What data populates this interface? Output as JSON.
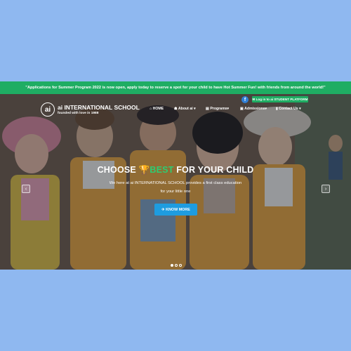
{
  "announcement": "\"Applications for Summer Program 2022 is now open, apply today to reserve a spot for your child to have Hot Summer Fun! with friends from around the world!\"",
  "logo": {
    "mark": "ai",
    "name": "ai INTERNATIONAL SCHOOL",
    "tagline": "founded with love in 1988"
  },
  "social": {
    "facebook_icon": "f"
  },
  "student_platform": "✉ Log in to ai STUDENT PLATFORM",
  "nav": {
    "home": "⌂ HOME",
    "about": "☗ About ai ▾",
    "programs": "▤ Programs▾",
    "admissions": "▣ Admissions▾",
    "contact": "▮ Contact Us ▾"
  },
  "hero": {
    "headline_pre": "CHOOSE ",
    "headline_icon": "🏆",
    "headline_accent": "BEST",
    "headline_post": " FOR YOUR CHILD",
    "sub_line1": "We here at ai INTERNATIONAL SCHOOL provides a first class education",
    "sub_line2": "for your little one",
    "cta": "✈ KNOW MORE",
    "prev": "‹",
    "next": "›"
  },
  "colors": {
    "accent_green": "#1fad63",
    "cta_blue": "#1e9ce0",
    "page_bg": "#8fb8f0"
  },
  "carousel": {
    "slides": 3,
    "active": 1
  }
}
